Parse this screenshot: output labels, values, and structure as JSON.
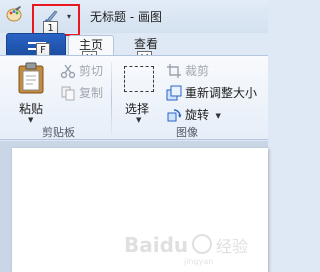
{
  "window": {
    "title": "无标题 - 画图"
  },
  "quick_access": {
    "dropdown_glyph": "▾",
    "keytips": {
      "brush": "1"
    }
  },
  "tabs": {
    "file_keytip": "F",
    "home_label": "主页",
    "home_keytip": "H",
    "view_label": "查看",
    "view_keytip": "V"
  },
  "clipboard": {
    "paste_label": "粘贴",
    "cut_label": "剪切",
    "copy_label": "复制",
    "group_label": "剪贴板"
  },
  "image": {
    "select_label": "选择",
    "crop_label": "裁剪",
    "resize_label": "重新调整大小",
    "rotate_label": "旋转",
    "group_label": "图像"
  },
  "watermark": {
    "text": "Baidu",
    "subtext": "jingyan"
  },
  "colors": {
    "highlight_border": "#e8191e",
    "file_tab": "#1f56b1",
    "canvas": "#ffffff"
  }
}
